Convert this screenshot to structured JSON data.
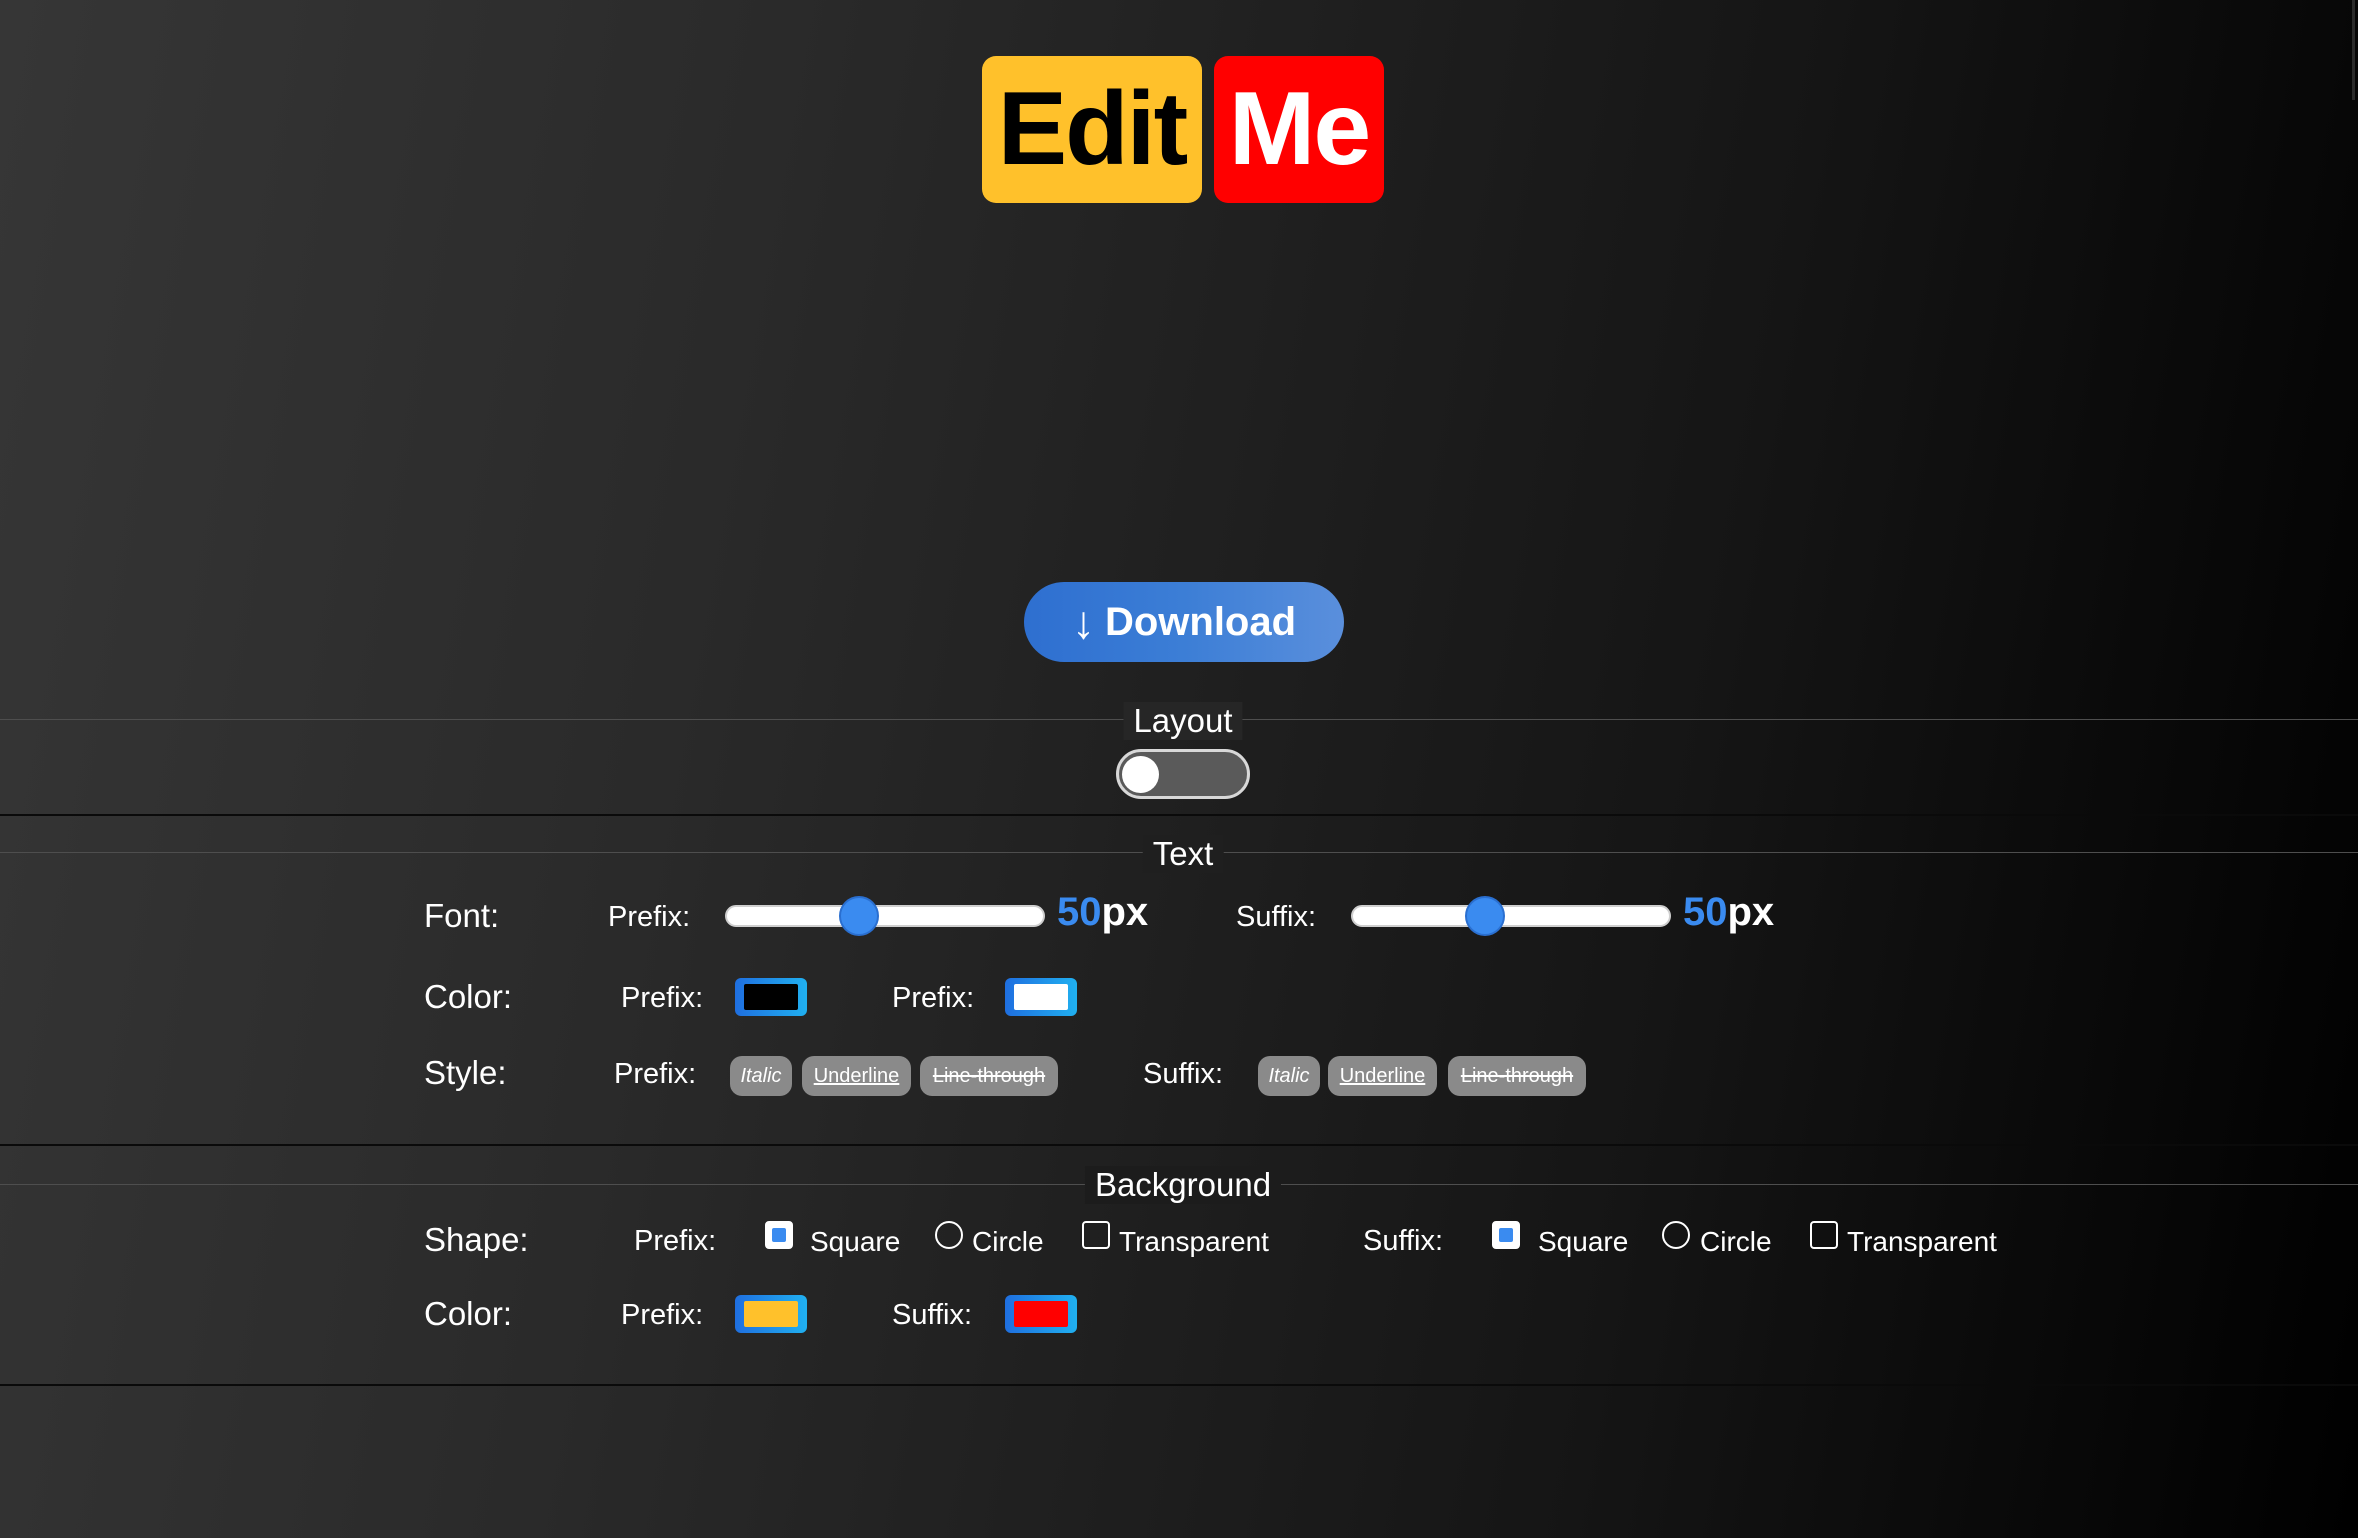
{
  "logo": {
    "prefix": "Edit",
    "suffix": "Me",
    "prefix_bg": "#ffc12b",
    "suffix_bg": "#ff0000"
  },
  "download": {
    "icon": "down-arrow-icon",
    "label": "Download"
  },
  "layout": {
    "title": "Layout",
    "toggle_on": false
  },
  "text": {
    "title": "Text",
    "font": {
      "label": "Font:",
      "prefix_label": "Prefix:",
      "prefix_value": "50",
      "prefix_unit": "px",
      "prefix_slider_fraction": 0.42,
      "suffix_label": "Suffix:",
      "suffix_value": "50",
      "suffix_unit": "px",
      "suffix_slider_fraction": 0.42
    },
    "color": {
      "label": "Color:",
      "prefix_label": "Prefix:",
      "prefix_color": "#000000",
      "suffix_label": "Prefix:",
      "suffix_color": "#ffffff"
    },
    "style": {
      "label": "Style:",
      "prefix_label": "Prefix:",
      "suffix_label": "Suffix:",
      "options": [
        "Italic",
        "Underline",
        "Line-through"
      ]
    }
  },
  "background": {
    "title": "Background",
    "shape": {
      "label": "Shape:",
      "prefix_label": "Prefix:",
      "suffix_label": "Suffix:",
      "options": [
        "Square",
        "Circle",
        "Transparent"
      ],
      "prefix_selected": "Square",
      "suffix_selected": "Square"
    },
    "color": {
      "label": "Color:",
      "prefix_label": "Prefix:",
      "prefix_color": "#ffc12b",
      "suffix_label": "Suffix:",
      "suffix_color": "#ff0000"
    }
  }
}
